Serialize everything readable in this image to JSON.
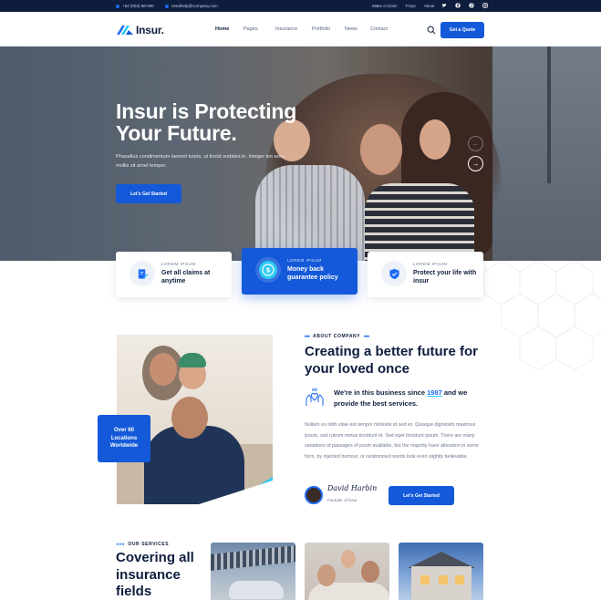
{
  "topbar": {
    "phone": "+92 (003) 68-090",
    "email": "needhelp@company.com",
    "links": [
      "Make a Claim",
      "FAQs",
      "About"
    ],
    "socials": [
      "twitter-icon",
      "facebook-icon",
      "pinterest-icon",
      "instagram-icon"
    ]
  },
  "header": {
    "logo": "Insur.",
    "nav": [
      "Home",
      "Pages",
      "Insurance",
      "Portfolio",
      "News",
      "Contact"
    ],
    "quote_button": "Get a Quote"
  },
  "hero": {
    "title_line1": "Insur is Protecting",
    "title_line2": "Your Future.",
    "subtitle": "Phasellus condimentum laoreet turpis, ut tincid sodales in. Integer leo arcu, mollis sit amet tempor.",
    "cta": "Let's Get Started"
  },
  "features": [
    {
      "small": "LOREM IPSUM",
      "label": "Get all claims at anytime",
      "icon": "document-edit-icon"
    },
    {
      "small": "LOREM IPSUM",
      "label": "Money back guarantee policy",
      "icon": "money-icon"
    },
    {
      "small": "LOREM IPSUM",
      "label": "Protect your life with insur",
      "icon": "shield-icon"
    }
  ],
  "about": {
    "tag": "ABOUT COMPANY",
    "title_line1": "Creating a better future for",
    "title_line2": "your loved once",
    "business_prefix": "We're in this business since",
    "business_year": "1987",
    "business_suffix": "and we provide the best services.",
    "body": "Nullam eu nibh vitae est tempor molestie id sed ex. Quisque dignissim maximus ipsum, sed rutrum metus tincidunt et. Sed eget tincidunt ipsum. There are many variations of passages of psum available, but the majority have alteration in some form, by injected humour, or randomised words look even slightly believable.",
    "signature": "David Harbin",
    "founder_role": "Founder of insur",
    "cta": "Let's Get Started",
    "badge_line1": "Over 60",
    "badge_line2": "Locations",
    "badge_line3": "Worldwide"
  },
  "services": {
    "tag": "OUR SERVICES",
    "title_line1": "Covering all",
    "title_line2": "insurance",
    "title_line3": "fields"
  },
  "colors": {
    "primary": "#1459d9",
    "navy": "#0e1d3d",
    "accent": "#2ecbf2"
  }
}
